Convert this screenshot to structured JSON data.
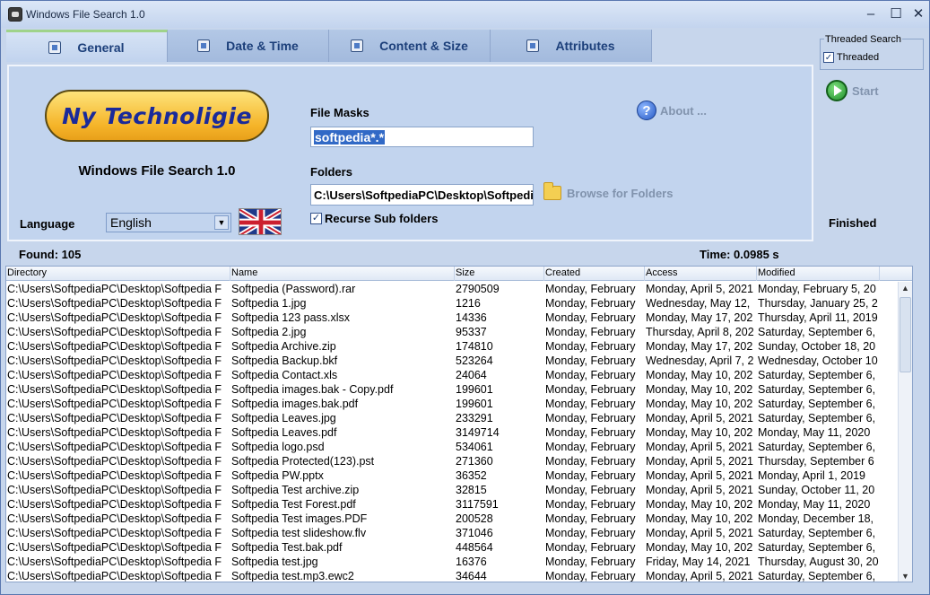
{
  "window": {
    "title": "Windows File Search 1.0"
  },
  "window_controls": {
    "minimize": "–",
    "maximize": "☐",
    "close": "✕"
  },
  "tabs": [
    {
      "label": "General",
      "icon": "magnifier-icon",
      "active": true
    },
    {
      "label": "Date & Time",
      "icon": "calendar-icon",
      "active": false
    },
    {
      "label": "Content & Size",
      "icon": "document-icon",
      "active": false
    },
    {
      "label": "Attributes",
      "icon": "edit-icon",
      "active": false
    }
  ],
  "general": {
    "logo_text": "Ny Technoligie",
    "app_name": "Windows File Search 1.0",
    "language_label": "Language",
    "language_value": "English",
    "file_masks_label": "File Masks",
    "file_masks_value": "softpedia*.*",
    "folders_label": "Folders",
    "folders_value": "C:\\Users\\SoftpediaPC\\Desktop\\Softpedi",
    "browse_label": "Browse for Folders",
    "recurse_label": "Recurse Sub folders",
    "recurse_checked": true,
    "about_label": "About ..."
  },
  "side": {
    "threaded_group_title": "Threaded Search",
    "threaded_label": "Threaded",
    "threaded_checked": true,
    "start_label": "Start",
    "status": "Finished"
  },
  "results": {
    "found": "Found: 105",
    "time": "Time: 0.0985 s",
    "columns": [
      "Directory",
      "Name",
      "Size",
      "Created",
      "Access",
      "Modified"
    ],
    "rows": [
      [
        "C:\\Users\\SoftpediaPC\\Desktop\\Softpedia F",
        "Softpedia (Password).rar",
        "2790509",
        "Monday, February",
        "Monday, April 5, 2021",
        "Monday, February 5, 20"
      ],
      [
        "C:\\Users\\SoftpediaPC\\Desktop\\Softpedia F",
        "Softpedia 1.jpg",
        "1216",
        "Monday, February",
        "Wednesday, May 12,",
        "Thursday, January 25, 2"
      ],
      [
        "C:\\Users\\SoftpediaPC\\Desktop\\Softpedia F",
        "Softpedia 123 pass.xlsx",
        "14336",
        "Monday, February",
        "Monday, May 17, 202",
        "Thursday, April 11, 2019"
      ],
      [
        "C:\\Users\\SoftpediaPC\\Desktop\\Softpedia F",
        "Softpedia 2.jpg",
        "95337",
        "Monday, February",
        "Thursday, April 8, 202",
        "Saturday, September 6,"
      ],
      [
        "C:\\Users\\SoftpediaPC\\Desktop\\Softpedia F",
        "Softpedia Archive.zip",
        "174810",
        "Monday, February",
        "Monday, May 17, 202",
        "Sunday, October 18, 20"
      ],
      [
        "C:\\Users\\SoftpediaPC\\Desktop\\Softpedia F",
        "Softpedia Backup.bkf",
        "523264",
        "Monday, February",
        "Wednesday, April 7, 2",
        "Wednesday, October 10"
      ],
      [
        "C:\\Users\\SoftpediaPC\\Desktop\\Softpedia F",
        "Softpedia Contact.xls",
        "24064",
        "Monday, February",
        "Monday, May 10, 202",
        "Saturday, September 6,"
      ],
      [
        "C:\\Users\\SoftpediaPC\\Desktop\\Softpedia F",
        "Softpedia images.bak - Copy.pdf",
        "199601",
        "Monday, February",
        "Monday, May 10, 202",
        "Saturday, September 6,"
      ],
      [
        "C:\\Users\\SoftpediaPC\\Desktop\\Softpedia F",
        "Softpedia images.bak.pdf",
        "199601",
        "Monday, February",
        "Monday, May 10, 202",
        "Saturday, September 6,"
      ],
      [
        "C:\\Users\\SoftpediaPC\\Desktop\\Softpedia F",
        "Softpedia Leaves.jpg",
        "233291",
        "Monday, February",
        "Monday, April 5, 2021",
        "Saturday, September 6,"
      ],
      [
        "C:\\Users\\SoftpediaPC\\Desktop\\Softpedia F",
        "Softpedia Leaves.pdf",
        "3149714",
        "Monday, February",
        "Monday, May 10, 202",
        "Monday, May 11, 2020"
      ],
      [
        "C:\\Users\\SoftpediaPC\\Desktop\\Softpedia F",
        "Softpedia logo.psd",
        "534061",
        "Monday, February",
        "Monday, April 5, 2021",
        "Saturday, September 6,"
      ],
      [
        "C:\\Users\\SoftpediaPC\\Desktop\\Softpedia F",
        "Softpedia Protected(123).pst",
        "271360",
        "Monday, February",
        "Monday, April 5, 2021",
        "Thursday, September 6"
      ],
      [
        "C:\\Users\\SoftpediaPC\\Desktop\\Softpedia F",
        "Softpedia PW.pptx",
        "36352",
        "Monday, February",
        "Monday, April 5, 2021",
        "Monday, April 1, 2019"
      ],
      [
        "C:\\Users\\SoftpediaPC\\Desktop\\Softpedia F",
        "Softpedia Test archive.zip",
        "32815",
        "Monday, February",
        "Monday, April 5, 2021",
        "Sunday, October 11, 20"
      ],
      [
        "C:\\Users\\SoftpediaPC\\Desktop\\Softpedia F",
        "Softpedia Test Forest.pdf",
        "3117591",
        "Monday, February",
        "Monday, May 10, 202",
        "Monday, May 11, 2020"
      ],
      [
        "C:\\Users\\SoftpediaPC\\Desktop\\Softpedia F",
        "Softpedia Test images.PDF",
        "200528",
        "Monday, February",
        "Monday, May 10, 202",
        "Monday, December 18,"
      ],
      [
        "C:\\Users\\SoftpediaPC\\Desktop\\Softpedia F",
        "Softpedia test slideshow.flv",
        "371046",
        "Monday, February",
        "Monday, April 5, 2021",
        "Saturday, September 6,"
      ],
      [
        "C:\\Users\\SoftpediaPC\\Desktop\\Softpedia F",
        "Softpedia Test.bak.pdf",
        "448564",
        "Monday, February",
        "Monday, May 10, 202",
        "Saturday, September 6,"
      ],
      [
        "C:\\Users\\SoftpediaPC\\Desktop\\Softpedia F",
        "Softpedia test.jpg",
        "16376",
        "Monday, February",
        "Friday, May 14, 2021",
        "Thursday, August 30, 20"
      ],
      [
        "C:\\Users\\SoftpediaPC\\Desktop\\Softpedia F",
        "Softpedia test.mp3.ewc2",
        "34644",
        "Monday, February",
        "Monday, April 5, 2021",
        "Saturday, September 6,"
      ]
    ]
  },
  "colors": {
    "window_bg": "#c7d6ec",
    "tab_text": "#1c3f7a",
    "selection": "#3169c6",
    "logo_fill": "#f5b429"
  }
}
